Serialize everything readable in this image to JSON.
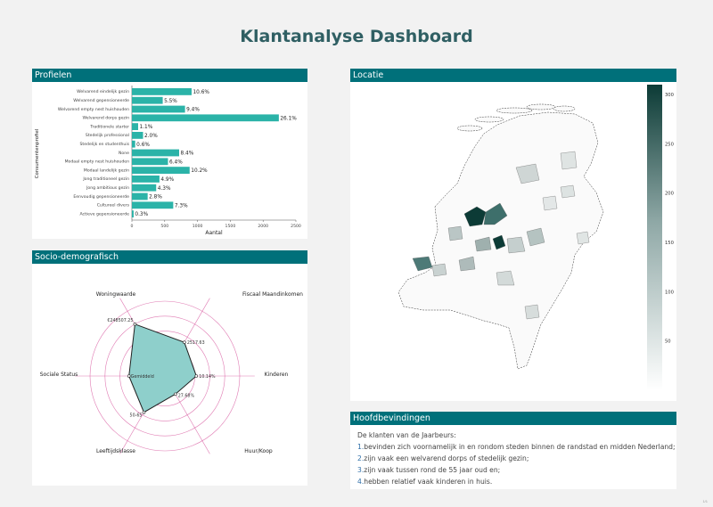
{
  "page_title": "Klantanalyse Dashboard",
  "sections": {
    "profielen": "Profielen",
    "locatie": "Locatie",
    "socio": "Socio-demografisch",
    "hoofd": "Hoofdbevindingen"
  },
  "colors": {
    "accent": "#00707a",
    "bar": "#2bb3a8",
    "radar_fill": "#8ecfcb",
    "radar_grid": "#d64f9a",
    "map_dark": "#0c3b36"
  },
  "chart_data": [
    {
      "type": "bar",
      "orientation": "horizontal",
      "ylabel": "Consumentenprofiel",
      "xlabel": "Aantal",
      "xlim": [
        0,
        2500
      ],
      "xticks": [
        "0",
        "500",
        "1000",
        "1500",
        "2000",
        "2500"
      ],
      "categories": [
        "Welvarend eindelijk gezin",
        "Welvarend gepensioneerde",
        "Welvarend empty nest huishouden",
        "Welvarend dorps gezin",
        "Traditionele starter",
        "Stedelijk professional",
        "Stedelijk en studenthuis",
        "None",
        "Modaal empty nest huishouden",
        "Modaal landelijk gezin",
        "Jong traditioneel gezin",
        "Jong ambitious gezin",
        "Eenvoudig gepensioneerde",
        "Cultureel divers",
        "Actieve gepensioneerde"
      ],
      "values": [
        910,
        470,
        810,
        2240,
        95,
        170,
        50,
        720,
        550,
        880,
        420,
        370,
        240,
        630,
        26
      ],
      "labels": [
        "10.6%",
        "5.5%",
        "9.4%",
        "26.1%",
        "1.1%",
        "2.0%",
        "0.6%",
        "8.4%",
        "6.4%",
        "10.2%",
        "4.9%",
        "4.3%",
        "2.8%",
        "7.3%",
        "0.3%"
      ]
    },
    {
      "type": "radar",
      "axes": [
        "Woningwaarde",
        "Fiscaal Maandinkomen",
        "Kinderen",
        "Huur/Koop",
        "Leeftijdsklasse",
        "Sociale Status"
      ],
      "values": [
        0.8,
        0.52,
        0.42,
        0.28,
        0.56,
        0.48
      ],
      "point_labels": [
        "€248507.25",
        "2517.63",
        "10.14%",
        "27.68%",
        "50-65",
        "Gemiddeld"
      ]
    },
    {
      "type": "heatmap",
      "title": "",
      "colorbar_ticks": [
        "300",
        "250",
        "200",
        "150",
        "100",
        "50"
      ],
      "colorbar_range": [
        0,
        310
      ]
    }
  ],
  "findings": {
    "intro": "De klanten van de Jaarbeurs:",
    "items": [
      {
        "num": "1.",
        "text": "bevinden zich voornamelijk in en rondom steden binnen de randstad en midden Nederland;"
      },
      {
        "num": "2.",
        "text": "zijn vaak een welvarend dorps of stedelijk gezin;"
      },
      {
        "num": "3.",
        "text": "zijn vaak tussen rond de 55 jaar oud en;"
      },
      {
        "num": "4.",
        "text": "hebben relatief vaak kinderen in huis."
      }
    ]
  },
  "page_number": "1/1"
}
